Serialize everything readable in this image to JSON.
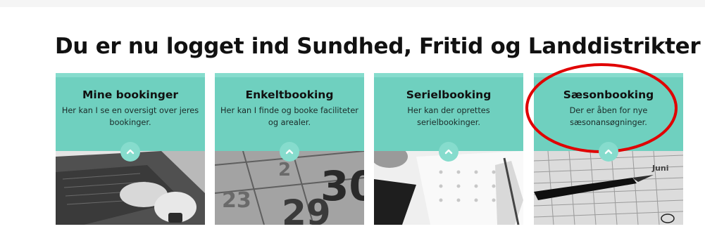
{
  "page": {
    "title": "Du er nu logget ind Sundhed, Fritid og Landdistrikter"
  },
  "cards": [
    {
      "title": "Mine bookinger",
      "text": "Her kan I se en oversigt over jeres bookinger."
    },
    {
      "title": "Enkeltbooking",
      "text": "Her kan I finde og booke faciliteter og arealer."
    },
    {
      "title": "Serielbooking",
      "text": "Her kan der oprettes serielbookinger."
    },
    {
      "title": "Sæsonbooking",
      "text": "Der er åben for nye sæsonansøgninger."
    }
  ],
  "calendar_numbers": {
    "n1": "30",
    "n2": "29",
    "n3": "23",
    "n4": "2"
  },
  "month_label": "Juni",
  "colors": {
    "card_head": "#6fd0bf",
    "card_top": "#86dccd",
    "highlight": "#e00000"
  },
  "icons": {
    "card_toggle": "chevron-up-icon"
  }
}
